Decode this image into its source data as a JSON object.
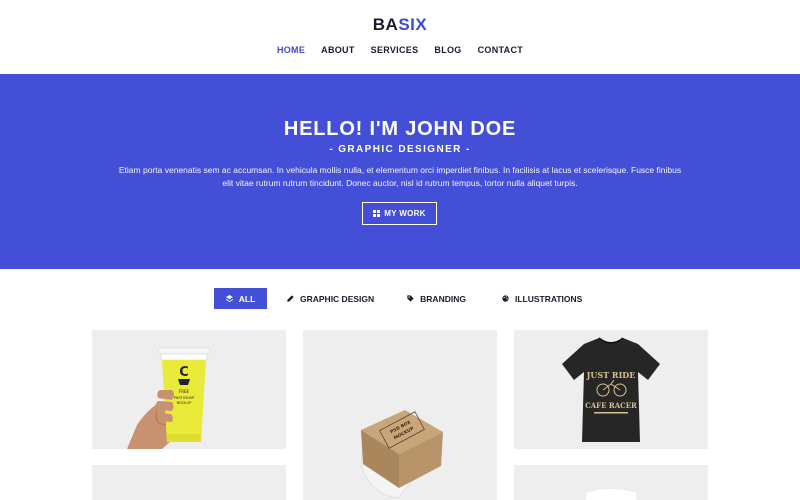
{
  "brand": {
    "logo_part1": "BA",
    "logo_part2": "SIX",
    "accent_color": "#3f47d6"
  },
  "nav": {
    "items": [
      {
        "label": "HOME",
        "active": true
      },
      {
        "label": "ABOUT",
        "active": false
      },
      {
        "label": "SERVICES",
        "active": false
      },
      {
        "label": "BLOG",
        "active": false
      },
      {
        "label": "CONTACT",
        "active": false
      }
    ]
  },
  "hero": {
    "background": "#444fd8",
    "title": "HELLO! I'M JOHN DOE",
    "subtitle": "- GRAPHIC DESIGNER -",
    "text": "Etiam porta venenatis sem ac accumsan. In vehicula mollis nulla, et elementum orci imperdiet finibus. In facilisis at lacus et scelerisque. Fusce finibus elit vitae rutrum rutrum tincidunt. Donec auctor, nisl id rutrum tempus, tortor nulla aliquet turpis.",
    "button_label": "MY WORK",
    "button_icon": "grid-icon"
  },
  "filters": [
    {
      "label": "ALL",
      "icon": "layers-icon",
      "active": true
    },
    {
      "label": "GRAPHIC DESIGN",
      "icon": "pencil-icon",
      "active": false
    },
    {
      "label": "BRANDING",
      "icon": "tag-icon",
      "active": false
    },
    {
      "label": "ILLUSTRATIONS",
      "icon": "palette-icon",
      "active": false
    }
  ],
  "portfolio": {
    "items": [
      {
        "image": "yellow coffee cup mockup",
        "cup_letter": "C",
        "cup_text_1": "FREE",
        "cup_text_2": "PHOTOSHOP",
        "cup_text_3": "MOCK-UP"
      },
      {
        "image": "kraft box mockup",
        "box_text_1": "PSD BOX",
        "box_text_2": "MOCKUP"
      },
      {
        "image": "black t-shirt mockup",
        "shirt_text_1": "JUST RIDE",
        "shirt_text_2": "CAFE RACER"
      },
      {
        "image": "portfolio item"
      },
      {
        "image": "portfolio item"
      }
    ]
  }
}
